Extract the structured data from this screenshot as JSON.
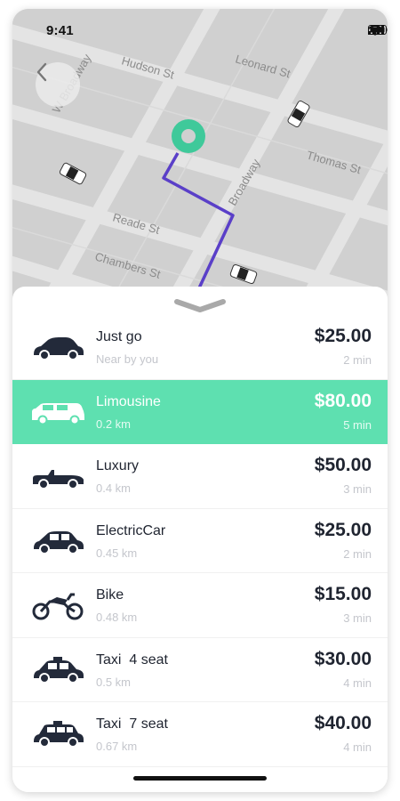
{
  "status_bar": {
    "time": "9:41"
  },
  "map": {
    "streets": [
      "W Broadway",
      "Reade St",
      "Chambers St",
      "Broadway",
      "Leonard St",
      "Hudson St",
      "Thomas St"
    ],
    "colors": {
      "background": "#d0d0d0",
      "road": "#e2e2e2",
      "route": "#5a3fc8",
      "pin": "#3fc99a"
    }
  },
  "back_button": {
    "icon": "chevron-left-icon"
  },
  "ride_options": [
    {
      "name": "Just go",
      "detail": "Near by you",
      "price": "$25.00",
      "eta": "2 min",
      "icon": "sedan-icon"
    },
    {
      "name": "Limousine",
      "detail": "0.2 km",
      "price": "$80.00",
      "eta": "5 min",
      "icon": "limousine-icon",
      "selected": true
    },
    {
      "name": "Luxury",
      "detail": "0.4 km",
      "price": "$50.00",
      "eta": "3 min",
      "icon": "convertible-icon"
    },
    {
      "name": "ElectricCar",
      "detail": "0.45 km",
      "price": "$25.00",
      "eta": "2 min",
      "icon": "electric-car-icon"
    },
    {
      "name": "Bike",
      "detail": "0.48 km",
      "price": "$15.00",
      "eta": "3 min",
      "icon": "motorbike-icon"
    },
    {
      "name": "Taxi  4 seat",
      "detail": "0.5 km",
      "price": "$30.00",
      "eta": "4 min",
      "icon": "taxi-icon"
    },
    {
      "name": "Taxi  7 seat",
      "detail": "0.67 km",
      "price": "$40.00",
      "eta": "4 min",
      "icon": "taxi-van-icon"
    }
  ],
  "colors": {
    "selected_row": "#5ee0b0",
    "text": "#1f2430",
    "muted": "#c4c6cc"
  }
}
